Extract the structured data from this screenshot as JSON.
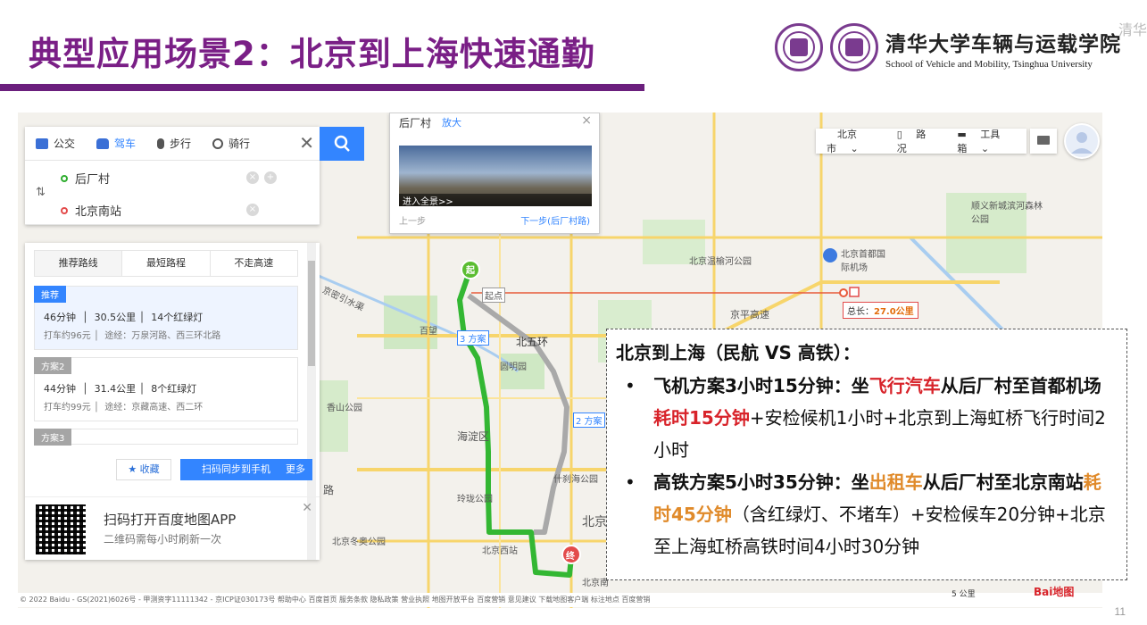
{
  "slide": {
    "title": "典型应用场景2：北京到上海快速通勤",
    "school_cn": "清华大学车辆与运载学院",
    "school_en": "School of Vehicle and Mobility, Tsinghua University",
    "corner_text": "清华",
    "page_number": "11"
  },
  "map": {
    "modes": [
      {
        "label": "公交",
        "icon": "bus-icon"
      },
      {
        "label": "驾车",
        "icon": "car-icon"
      },
      {
        "label": "步行",
        "icon": "walk-icon"
      },
      {
        "label": "骑行",
        "icon": "bike-icon"
      }
    ],
    "start": "后厂村",
    "end": "北京南站",
    "tabs": [
      "推荐路线",
      "最短路程",
      "不走高速"
    ],
    "plans": [
      {
        "tag": "推荐",
        "time": "46分钟",
        "distance": "30.5公里",
        "lights": "14个红绿灯",
        "taxi": "打车约96元",
        "via": "途经：万泉河路、西三环北路"
      },
      {
        "tag": "方案2",
        "time": "44分钟",
        "distance": "31.4公里",
        "lights": "8个红绿灯",
        "taxi": "打车约99元",
        "via": "途经：京藏高速、西二环"
      },
      {
        "tag": "方案3"
      }
    ],
    "fav_label": "收藏",
    "sync_label": "扫码同步到手机",
    "more_label": "更多",
    "qr_title": "扫码打开百度地图APP",
    "qr_sub": "二维码需每小时刷新一次",
    "popup": {
      "title": "后厂村",
      "zoom": "放大",
      "pano": "进入全景>>",
      "prev": "上一步",
      "next": "下一步(后厂村路)"
    },
    "city": "北京市",
    "traffic": "路况",
    "toolbox": "工具箱",
    "labels": {
      "start_marker": "起",
      "end_marker": "终",
      "origin_tag": "起点",
      "plan3_tag": "3 方案",
      "plan2_tag": "2 方案",
      "north5": "北五环",
      "yuanmingyuan": "圆明园",
      "haidian": "海淀区",
      "xiangshan": "香山公园",
      "linglong": "玲珑公园",
      "xisanqi": "北京温榆河公园",
      "airport": "北京首都国际机场",
      "shunyi": "顺义新城滨河森林公园",
      "jingping": "京平高速",
      "beijing_west": "北京西站",
      "beijing_south": "北京南",
      "dongsi": "北京冬奥公园",
      "shichahai": "什刹海公园",
      "beijing": "北京",
      "jingmi": "京密引水渠",
      "baiwang": "百望",
      "road": "路"
    },
    "total_label": "总长：",
    "total_value": "27.0公里",
    "footer": "© 2022 Baidu - GS(2021)6026号 - 甲测资字11111342 - 京ICP证030173号   帮助中心   百度首页   服务条款   隐私政策   营业执照   地图开放平台   百度营销   意见建议   下载地图客户端   标注地点   百度营销",
    "scale": "5 公里",
    "logo": "Bai地图"
  },
  "textbox": {
    "heading": "北京到上海（民航 VS 高铁）：",
    "item1": {
      "a": "飞机方案3小时15分钟：坐",
      "b": "飞行汽车",
      "c": "从后厂村至首都机场",
      "d": "耗时15分钟",
      "e": "+安检候机1小时+北京到上海虹桥飞行时间2小时"
    },
    "item2": {
      "a": "高铁方案5小时35分钟：坐",
      "b": "出租车",
      "c": "从后厂村至北京南站",
      "d": "耗时45分钟",
      "e": "（含红绿灯、不堵车）+安检候车20分钟+北京至上海虹桥高铁时间4小时30分钟"
    }
  },
  "colors": {
    "title": "#7a1f86",
    "route_main": "#33b733",
    "route_alt": "#a9a9a9",
    "flight_line": "#e85a3a",
    "highlight_red": "#d8232a",
    "highlight_orange": "#e08a2a",
    "accent": "#3385ff"
  }
}
